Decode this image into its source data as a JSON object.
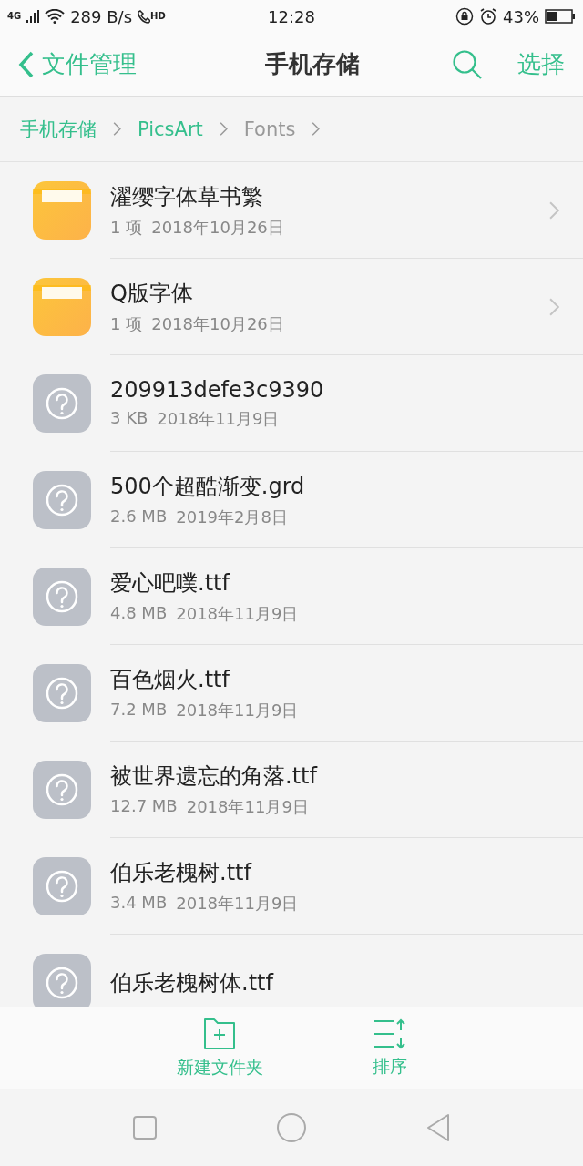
{
  "status_bar": {
    "network": "4G",
    "speed": "289 B/s",
    "call_badge": "HD",
    "time": "12:28",
    "battery": "43%"
  },
  "header": {
    "back_label": "文件管理",
    "title": "手机存储",
    "action": "选择"
  },
  "breadcrumb": [
    {
      "label": "手机存储",
      "current": false
    },
    {
      "label": "PicsArt",
      "current": false
    },
    {
      "label": "Fonts",
      "current": true
    }
  ],
  "items": [
    {
      "kind": "folder",
      "name": "濯缨字体草书繁",
      "size": "1 项",
      "date": "2018年10月26日"
    },
    {
      "kind": "folder",
      "name": "Q版字体",
      "size": "1 项",
      "date": "2018年10月26日"
    },
    {
      "kind": "file",
      "name": "209913defe3c9390",
      "size": "3 KB",
      "date": "2018年11月9日"
    },
    {
      "kind": "file",
      "name": "500个超酷渐变.grd",
      "size": "2.6 MB",
      "date": "2019年2月8日"
    },
    {
      "kind": "file",
      "name": "爱心吧噗.ttf",
      "size": "4.8 MB",
      "date": "2018年11月9日"
    },
    {
      "kind": "file",
      "name": "百色烟火.ttf",
      "size": "7.2 MB",
      "date": "2018年11月9日"
    },
    {
      "kind": "file",
      "name": "被世界遗忘的角落.ttf",
      "size": "12.7 MB",
      "date": "2018年11月9日"
    },
    {
      "kind": "file",
      "name": "伯乐老槐树.ttf",
      "size": "3.4 MB",
      "date": "2018年11月9日"
    },
    {
      "kind": "file",
      "name": "伯乐老槐树体.ttf"
    }
  ],
  "toolbar": [
    {
      "kind": "new-folder",
      "label": "新建文件夹"
    },
    {
      "kind": "sort",
      "label": "排序"
    }
  ]
}
